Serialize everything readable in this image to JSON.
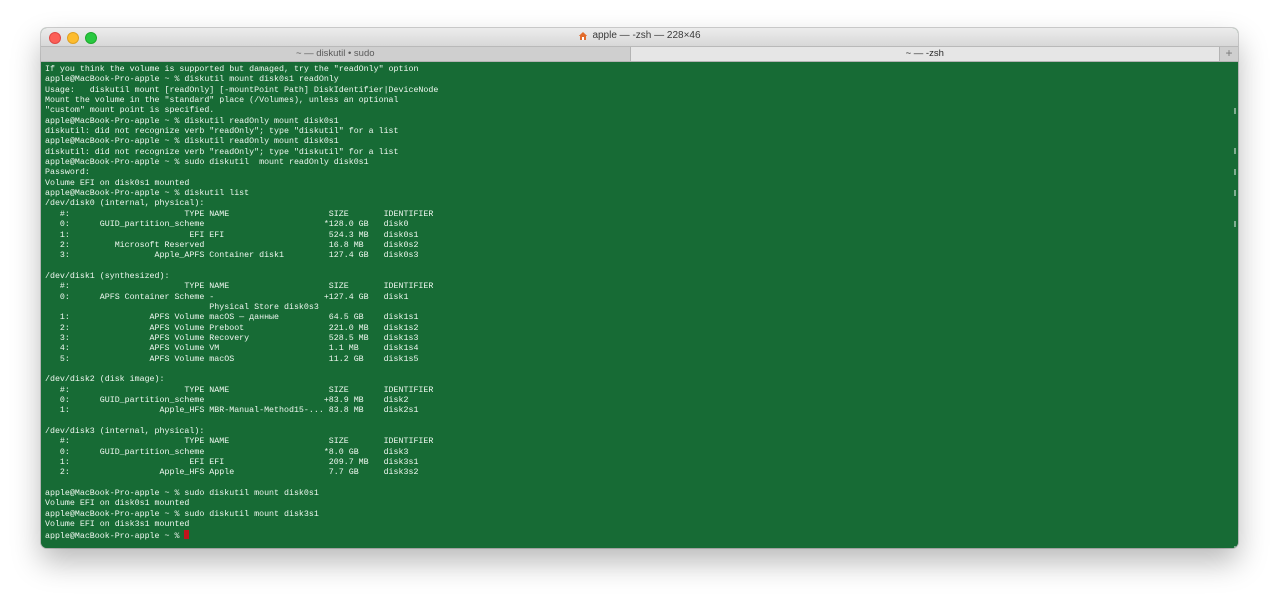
{
  "window": {
    "title": "apple — -zsh — 228×46",
    "tabs": [
      {
        "label": "~ — diskutil • sudo",
        "active": false
      },
      {
        "label": "~ — -zsh",
        "active": true
      }
    ],
    "new_tab_label": "+"
  },
  "colors": {
    "background": "#176b35",
    "text": "#eef7ef",
    "cursor": "#c0141c"
  },
  "terminal": {
    "lines": [
      "If you think the volume is supported but damaged, try the \"readOnly\" option",
      "apple@MacBook-Pro-apple ~ % diskutil mount disk0s1 readOnly",
      "Usage:   diskutil mount [readOnly] [-mountPoint Path] DiskIdentifier|DeviceNode",
      "Mount the volume in the \"standard\" place (/Volumes), unless an optional",
      "\"custom\" mount point is specified.",
      "apple@MacBook-Pro-apple ~ % diskutil readOnly mount disk0s1",
      "diskutil: did not recognize verb \"readOnly\"; type \"diskutil\" for a list",
      "apple@MacBook-Pro-apple ~ % diskutil readOnly mount disk0s1",
      "diskutil: did not recognize verb \"readOnly\"; type \"diskutil\" for a list",
      "apple@MacBook-Pro-apple ~ % sudo diskutil  mount readOnly disk0s1",
      "Password:",
      "Volume EFI on disk0s1 mounted",
      "apple@MacBook-Pro-apple ~ % diskutil list",
      "/dev/disk0 (internal, physical):",
      "   #:                       TYPE NAME                    SIZE       IDENTIFIER",
      "   0:      GUID_partition_scheme                        *128.0 GB   disk0",
      "   1:                        EFI EFI                     524.3 MB   disk0s1",
      "   2:         Microsoft Reserved                         16.8 MB    disk0s2",
      "   3:                 Apple_APFS Container disk1         127.4 GB   disk0s3",
      "",
      "/dev/disk1 (synthesized):",
      "   #:                       TYPE NAME                    SIZE       IDENTIFIER",
      "   0:      APFS Container Scheme -                      +127.4 GB   disk1",
      "                                 Physical Store disk0s3",
      "   1:                APFS Volume macOS — данные          64.5 GB    disk1s1",
      "   2:                APFS Volume Preboot                 221.0 MB   disk1s2",
      "   3:                APFS Volume Recovery                528.5 MB   disk1s3",
      "   4:                APFS Volume VM                      1.1 MB     disk1s4",
      "   5:                APFS Volume macOS                   11.2 GB    disk1s5",
      "",
      "/dev/disk2 (disk image):",
      "   #:                       TYPE NAME                    SIZE       IDENTIFIER",
      "   0:      GUID_partition_scheme                        +83.9 MB    disk2",
      "   1:                  Apple_HFS MBR-Manual-Method15-... 83.8 MB    disk2s1",
      "",
      "/dev/disk3 (internal, physical):",
      "   #:                       TYPE NAME                    SIZE       IDENTIFIER",
      "   0:      GUID_partition_scheme                        *8.0 GB     disk3",
      "   1:                        EFI EFI                     209.7 MB   disk3s1",
      "   2:                  Apple_HFS Apple                   7.7 GB     disk3s2",
      "",
      "apple@MacBook-Pro-apple ~ % sudo diskutil mount disk0s1",
      "Volume EFI on disk0s1 mounted",
      "apple@MacBook-Pro-apple ~ % sudo diskutil mount disk3s1",
      "Volume EFI on disk3s1 mounted"
    ],
    "prompt": "apple@MacBook-Pro-apple ~ % "
  }
}
